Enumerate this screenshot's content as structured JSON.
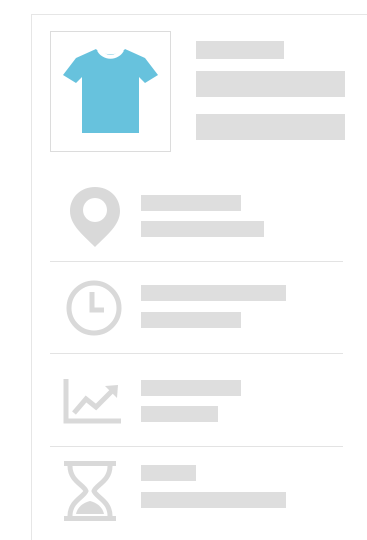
{
  "product": {
    "icon": "tshirt-icon",
    "accent_color": "#67c2dd"
  },
  "rows": [
    {
      "icon": "location-pin-icon"
    },
    {
      "icon": "clock-icon"
    },
    {
      "icon": "trend-chart-icon"
    },
    {
      "icon": "hourglass-icon"
    }
  ],
  "colors": {
    "placeholder": "#dedede",
    "icon_gray": "#d9d9d9",
    "divider": "#e3e3e3"
  }
}
